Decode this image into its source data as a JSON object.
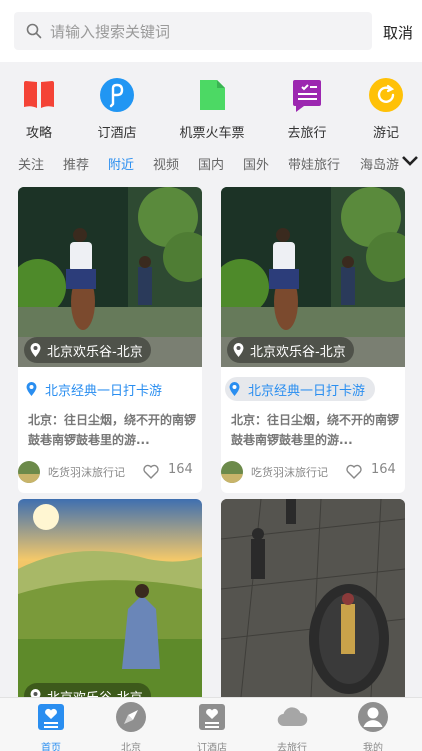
{
  "search": {
    "placeholder": "请输入搜索关键词",
    "cancel_label": "取消"
  },
  "quick_nav": [
    {
      "label": "攻略",
      "icon": "bookmark-icon",
      "color": "#f44336"
    },
    {
      "label": "订酒店",
      "icon": "hotel-icon",
      "color": "#2196f3"
    },
    {
      "label": "机票火车票",
      "icon": "ticket-icon",
      "color": "#4cd964"
    },
    {
      "label": "去旅行",
      "icon": "travel-icon",
      "color": "#9c27b0"
    },
    {
      "label": "游记",
      "icon": "notes-icon",
      "color": "#ffc107"
    }
  ],
  "tabs": [
    "关注",
    "推荐",
    "附近",
    "视频",
    "国内",
    "国外",
    "带娃旅行",
    "海岛游"
  ],
  "active_tab": "附近",
  "cards": [
    {
      "location": "北京欢乐谷-北京",
      "route": "北京经典一日打卡游",
      "description": "北京：往日尘烟，绕不开的南锣鼓巷南锣鼓巷里的游...",
      "author": "吃货羽沫旅行记",
      "likes": "164"
    },
    {
      "location": "北京欢乐谷-北京",
      "route": "北京经典一日打卡游",
      "description": "北京：往日尘烟，绕不开的南锣鼓巷南锣鼓巷里的游...",
      "author": "吃货羽沫旅行记",
      "likes": "164"
    },
    {
      "location": "北京欢乐谷-北京"
    },
    {}
  ],
  "bottom_nav": [
    {
      "label": "首页",
      "icon": "home-icon"
    },
    {
      "label": "北京",
      "icon": "compass-icon"
    },
    {
      "label": "订酒店",
      "icon": "hotel-icon"
    },
    {
      "label": "去旅行",
      "icon": "cloud-icon"
    },
    {
      "label": "我的",
      "icon": "profile-icon"
    }
  ],
  "active_bottom": "首页",
  "colors": {
    "accent": "#2a8ef0",
    "background": "#f2f2f4"
  }
}
